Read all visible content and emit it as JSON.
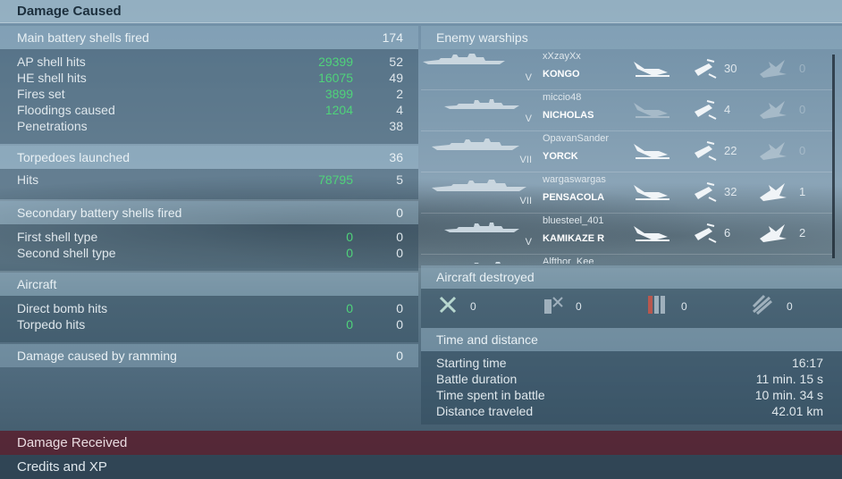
{
  "headers": {
    "damage_caused": "Damage Caused",
    "damage_received": "Damage Received",
    "credits_xp": "Credits and XP"
  },
  "main_battery": {
    "title": "Main battery shells fired",
    "total": "174",
    "rows": [
      {
        "label": "AP shell hits",
        "damage": "29399",
        "count": "52"
      },
      {
        "label": "HE shell hits",
        "damage": "16075",
        "count": "49"
      },
      {
        "label": "Fires set",
        "damage": "3899",
        "count": "2"
      },
      {
        "label": "Floodings caused",
        "damage": "1204",
        "count": "4"
      },
      {
        "label": "Penetrations",
        "damage": "",
        "count": "38"
      }
    ]
  },
  "torpedoes": {
    "title": "Torpedoes launched",
    "total": "36",
    "rows": [
      {
        "label": "Hits",
        "damage": "78795",
        "count": "5"
      }
    ]
  },
  "secondary": {
    "title": "Secondary battery shells fired",
    "total": "0",
    "rows": [
      {
        "label": "First shell type",
        "damage": "0",
        "count": "0"
      },
      {
        "label": "Second shell type",
        "damage": "0",
        "count": "0"
      }
    ]
  },
  "aircraft": {
    "title": "Aircraft",
    "rows": [
      {
        "label": "Direct bomb hits",
        "damage": "0",
        "count": "0"
      },
      {
        "label": "Torpedo hits",
        "damage": "0",
        "count": "0"
      }
    ]
  },
  "ramming": {
    "title": "Damage caused by ramming",
    "total": "0"
  },
  "enemy_warships": {
    "title": "Enemy warships",
    "icons": [
      "sinking-ship-icon",
      "torpedo-hit-icon",
      "fire-icon"
    ],
    "ships": [
      {
        "tier": "V",
        "player": "xXzayXx",
        "name": "KONGO",
        "a": "",
        "b": "30",
        "c": "0"
      },
      {
        "tier": "V",
        "player": "miccio48",
        "name": "NICHOLAS",
        "a": "",
        "b": "4",
        "c": "0"
      },
      {
        "tier": "VII",
        "player": "OpavanSander",
        "name": "YORCK",
        "a": "",
        "b": "22",
        "c": "0"
      },
      {
        "tier": "VII",
        "player": "wargaswargas",
        "name": "PENSACOLA",
        "a": "",
        "b": "32",
        "c": "1"
      },
      {
        "tier": "V",
        "player": "bluesteel_401",
        "name": "KAMIKAZE R",
        "a": "",
        "b": "6",
        "c": "2"
      },
      {
        "tier": "",
        "player": "Alfthor_Kee",
        "name": "",
        "a": "",
        "b": "",
        "c": ""
      }
    ]
  },
  "aircraft_destroyed": {
    "title": "Aircraft destroyed",
    "items": [
      {
        "icon": "fighter-plane-icon",
        "value": "0"
      },
      {
        "icon": "bomb-icon",
        "value": "0"
      },
      {
        "icon": "torpedo-icon",
        "value": "0"
      },
      {
        "icon": "rocket-icon",
        "value": "0"
      }
    ]
  },
  "time_distance": {
    "title": "Time and distance",
    "rows": [
      {
        "label": "Starting time",
        "value": "16:17"
      },
      {
        "label": "Battle duration",
        "value": "11 min. 15 s"
      },
      {
        "label": "Time spent in battle",
        "value": "10 min. 34 s"
      },
      {
        "label": "Distance traveled",
        "value": "42.01 km"
      }
    ]
  },
  "colors": {
    "damage_green": "#4fd37a",
    "damage_received_bg": "#5a1928"
  }
}
